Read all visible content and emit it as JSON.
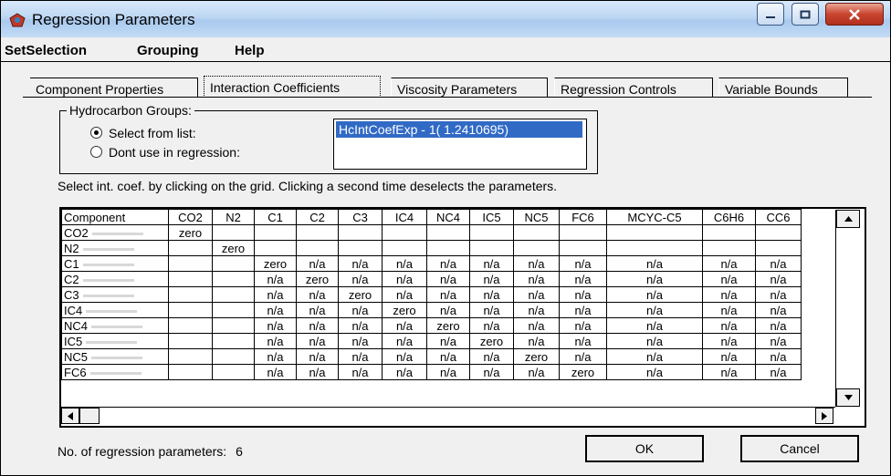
{
  "window": {
    "title": "Regression Parameters"
  },
  "menu": [
    "SetSelection",
    "Grouping",
    "Help"
  ],
  "tabs": [
    "Component Properties",
    "Interaction Coefficients",
    "Viscosity Parameters",
    "Regression Controls",
    "Variable Bounds"
  ],
  "active_tab": "Interaction Coefficients",
  "hydrocarbon_groups": {
    "label": "Hydrocarbon Groups:",
    "option_select": "Select from list:",
    "option_dont": "Dont use in regression:",
    "selected_option": "Select from list:",
    "list_items": [
      "HcIntCoefExp - 1( 1.2410695)"
    ]
  },
  "hint": "Select int. coef. by clicking on the grid.  Clicking a second time deselects the parameters.",
  "grid": {
    "columns": [
      "Component",
      "CO2",
      "N2",
      "C1",
      "C2",
      "C3",
      "IC4",
      "NC4",
      "IC5",
      "NC5",
      "FC6",
      "MCYC-C5",
      "C6H6",
      "CC6"
    ],
    "rows": [
      {
        "name": "CO2",
        "cells": [
          "zero",
          "",
          "",
          "",
          "",
          "",
          "",
          "",
          "",
          "",
          "",
          "",
          ""
        ]
      },
      {
        "name": "N2",
        "cells": [
          "",
          "zero",
          "",
          "",
          "",
          "",
          "",
          "",
          "",
          "",
          "",
          "",
          ""
        ]
      },
      {
        "name": "C1",
        "cells": [
          "",
          "",
          "zero",
          "n/a",
          "n/a",
          "n/a",
          "n/a",
          "n/a",
          "n/a",
          "n/a",
          "n/a",
          "n/a",
          "n/a"
        ]
      },
      {
        "name": "C2",
        "cells": [
          "",
          "",
          "n/a",
          "zero",
          "n/a",
          "n/a",
          "n/a",
          "n/a",
          "n/a",
          "n/a",
          "n/a",
          "n/a",
          "n/a"
        ]
      },
      {
        "name": "C3",
        "cells": [
          "",
          "",
          "n/a",
          "n/a",
          "zero",
          "n/a",
          "n/a",
          "n/a",
          "n/a",
          "n/a",
          "n/a",
          "n/a",
          "n/a"
        ]
      },
      {
        "name": "IC4",
        "cells": [
          "",
          "",
          "n/a",
          "n/a",
          "n/a",
          "zero",
          "n/a",
          "n/a",
          "n/a",
          "n/a",
          "n/a",
          "n/a",
          "n/a"
        ]
      },
      {
        "name": "NC4",
        "cells": [
          "",
          "",
          "n/a",
          "n/a",
          "n/a",
          "n/a",
          "zero",
          "n/a",
          "n/a",
          "n/a",
          "n/a",
          "n/a",
          "n/a"
        ]
      },
      {
        "name": "IC5",
        "cells": [
          "",
          "",
          "n/a",
          "n/a",
          "n/a",
          "n/a",
          "n/a",
          "zero",
          "n/a",
          "n/a",
          "n/a",
          "n/a",
          "n/a"
        ]
      },
      {
        "name": "NC5",
        "cells": [
          "",
          "",
          "n/a",
          "n/a",
          "n/a",
          "n/a",
          "n/a",
          "n/a",
          "zero",
          "n/a",
          "n/a",
          "n/a",
          "n/a"
        ]
      },
      {
        "name": "FC6",
        "cells": [
          "",
          "",
          "n/a",
          "n/a",
          "n/a",
          "n/a",
          "n/a",
          "n/a",
          "n/a",
          "zero",
          "n/a",
          "n/a",
          "n/a"
        ]
      }
    ]
  },
  "status": {
    "label": "No. of regression parameters:",
    "count": "6"
  },
  "buttons": {
    "ok": "OK",
    "cancel": "Cancel"
  },
  "colors": {
    "selection": "#316ac5",
    "close_button": "#c9452f"
  }
}
